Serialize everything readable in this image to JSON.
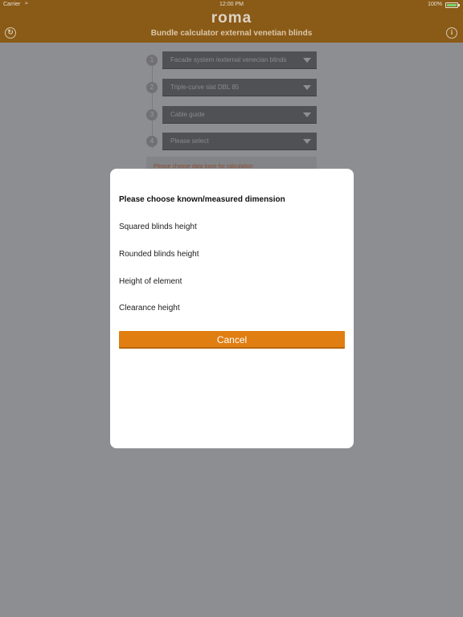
{
  "statusbar": {
    "carrier": "Carrier",
    "wifi_icon": "wifi-icon",
    "time": "12:00 PM",
    "battery_percent": "100%",
    "battery_level": 1.0
  },
  "navbar": {
    "logo": "roma",
    "title": "Bundle calculator external venetian blinds",
    "refresh_icon": "refresh-icon",
    "info_icon": "info-icon",
    "info_glyph": "i",
    "color": "#8a5a17"
  },
  "steps": [
    {
      "number": "1",
      "value": "Facade system /external venecian blinds"
    },
    {
      "number": "2",
      "value": "Triple-curve slat DBL 85"
    },
    {
      "number": "3",
      "value": "Cable guide"
    },
    {
      "number": "4",
      "value": "Please select"
    }
  ],
  "hint": "Please choose data base for calculation",
  "modal": {
    "heading": "Please choose known/measured dimension",
    "options": [
      "Squared blinds height",
      "Rounded blinds height",
      "Height of element",
      "Clearance height"
    ],
    "cancel_label": "Cancel",
    "accent": "#e07e11"
  }
}
